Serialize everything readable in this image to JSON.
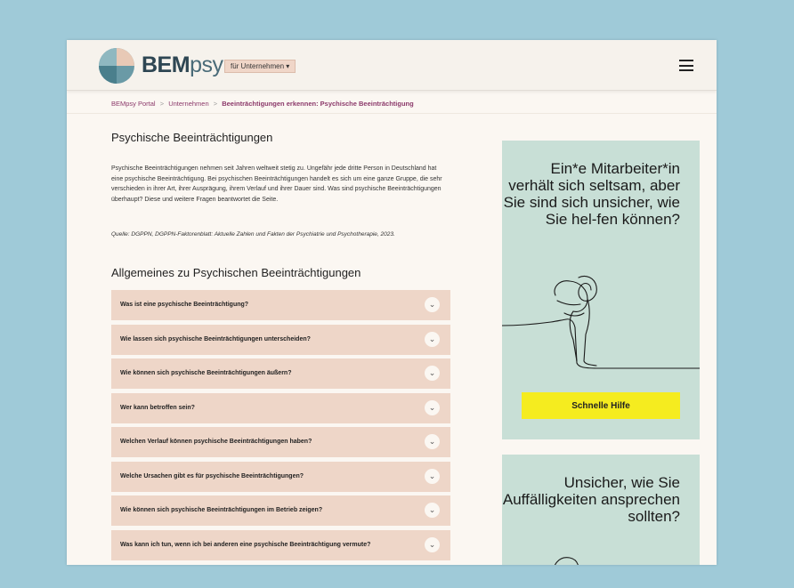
{
  "header": {
    "logo_bold": "BEM",
    "logo_light": "psy",
    "audience_dropdown": "für Unternehmen ▾"
  },
  "breadcrumb": {
    "items": [
      "BEMpsy Portal",
      "Unternehmen"
    ],
    "separator": ">",
    "current": "Beeinträchtigungen erkennen: Psychische Beeinträchtigung"
  },
  "main": {
    "title": "Psychische Beeinträchtigungen",
    "intro": "Psychische Beeinträchtigungen nehmen seit Jahren weltweit stetig zu. Ungefähr jede dritte Person in Deutschland hat eine psychische Beeinträchtigung. Bei psychischen Beeinträchtigungen handelt es sich um eine ganze Gruppe, die sehr verschieden in ihrer Art, ihrer Ausprägung, ihrem Verlauf und ihrer Dauer sind. Was sind psychische Beeinträchtigungen überhaupt? Diese und weitere Fragen beantwortet die Seite.",
    "source": "Quelle: DGPPN, DGPPN-Faktorenblatt: Aktuelle Zahlen und Fakten der Psychiatrie und Psychotherapie, 2023.",
    "section_title": "Allgemeines zu Psychischen Beeinträchtigungen",
    "faq": [
      "Was ist eine psychische Beeinträchtigung?",
      "Wie lassen sich psychische Beeinträchtigungen unterscheiden?",
      "Wie können sich psychische Beeinträchtigungen äußern?",
      "Wer kann betroffen sein?",
      "Welchen Verlauf können psychische Beeinträchtigungen haben?",
      "Welche Ursachen gibt es für psychische Beeinträchtigungen?",
      "Wie können sich psychische Beeinträchtigungen im Betrieb zeigen?",
      "Was kann ich tun, wenn ich bei anderen eine psychische Beeinträchtigung vermute?"
    ]
  },
  "sidebar": {
    "card1_headline": "Ein*e Mitarbeiter*in verhält sich seltsam, aber Sie sind sich unsicher, wie Sie hel-fen können?",
    "card1_button": "Schnelle Hilfe",
    "card2_headline": "Unsicher, wie Sie Auffälligkeiten ansprechen sollten?"
  },
  "colors": {
    "background": "#9fcad8",
    "accordion": "#eed6c8",
    "card": "#c8dfd6",
    "button": "#f5ec1f",
    "breadcrumb": "#8c3a6b"
  },
  "icons": [
    "menu-icon",
    "chevron-down-icon"
  ]
}
